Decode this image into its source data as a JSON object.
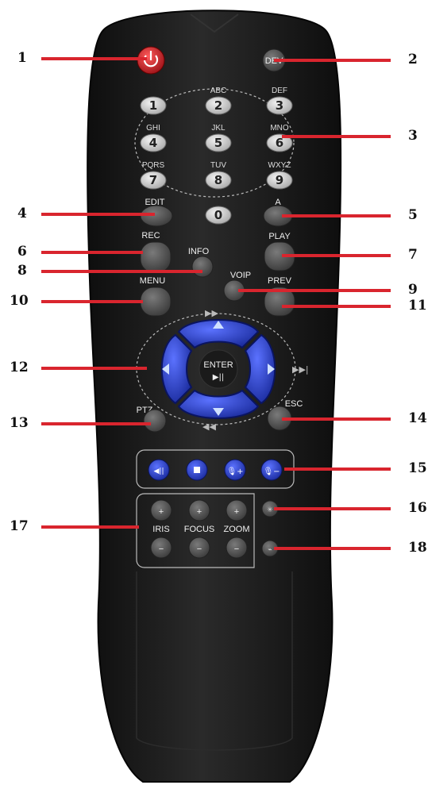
{
  "remote": {
    "power_icon": "power-icon",
    "dev_label": "DEV",
    "number_keys": [
      {
        "digit": "1",
        "letters": ""
      },
      {
        "digit": "2",
        "letters": "ABC"
      },
      {
        "digit": "3",
        "letters": "DEF"
      },
      {
        "digit": "4",
        "letters": "GHI"
      },
      {
        "digit": "5",
        "letters": "JKL"
      },
      {
        "digit": "6",
        "letters": "MNO"
      },
      {
        "digit": "7",
        "letters": "PQRS"
      },
      {
        "digit": "8",
        "letters": "TUV"
      },
      {
        "digit": "9",
        "letters": "WXYZ"
      },
      {
        "digit": "0",
        "letters": ""
      }
    ],
    "edit_label": "EDIT",
    "a_label": "A",
    "rec_label": "REC",
    "info_label": "INFO",
    "play_label": "PLAY",
    "voip_label": "VOIP",
    "menu_label": "MENU",
    "prev_label": "PREV",
    "enter_label": "ENTER",
    "enter_icon": "play-pause-icon",
    "ptz_label": "PTZ",
    "esc_label": "ESC",
    "iris_label": "IRIS",
    "focus_label": "FOCUS",
    "zoom_label": "ZOOM",
    "plus_sign": "+",
    "minus_sign": "−",
    "colors": {
      "body": "#1c1c1c",
      "gray_button": "#4a4a4a",
      "blue_button": "#2238b8",
      "power_red": "#c8202a",
      "callout_red": "#d9252e"
    }
  },
  "callouts": [
    "1",
    "2",
    "3",
    "4",
    "5",
    "6",
    "7",
    "8",
    "9",
    "10",
    "11",
    "12",
    "13",
    "14",
    "15",
    "16",
    "17",
    "18"
  ]
}
